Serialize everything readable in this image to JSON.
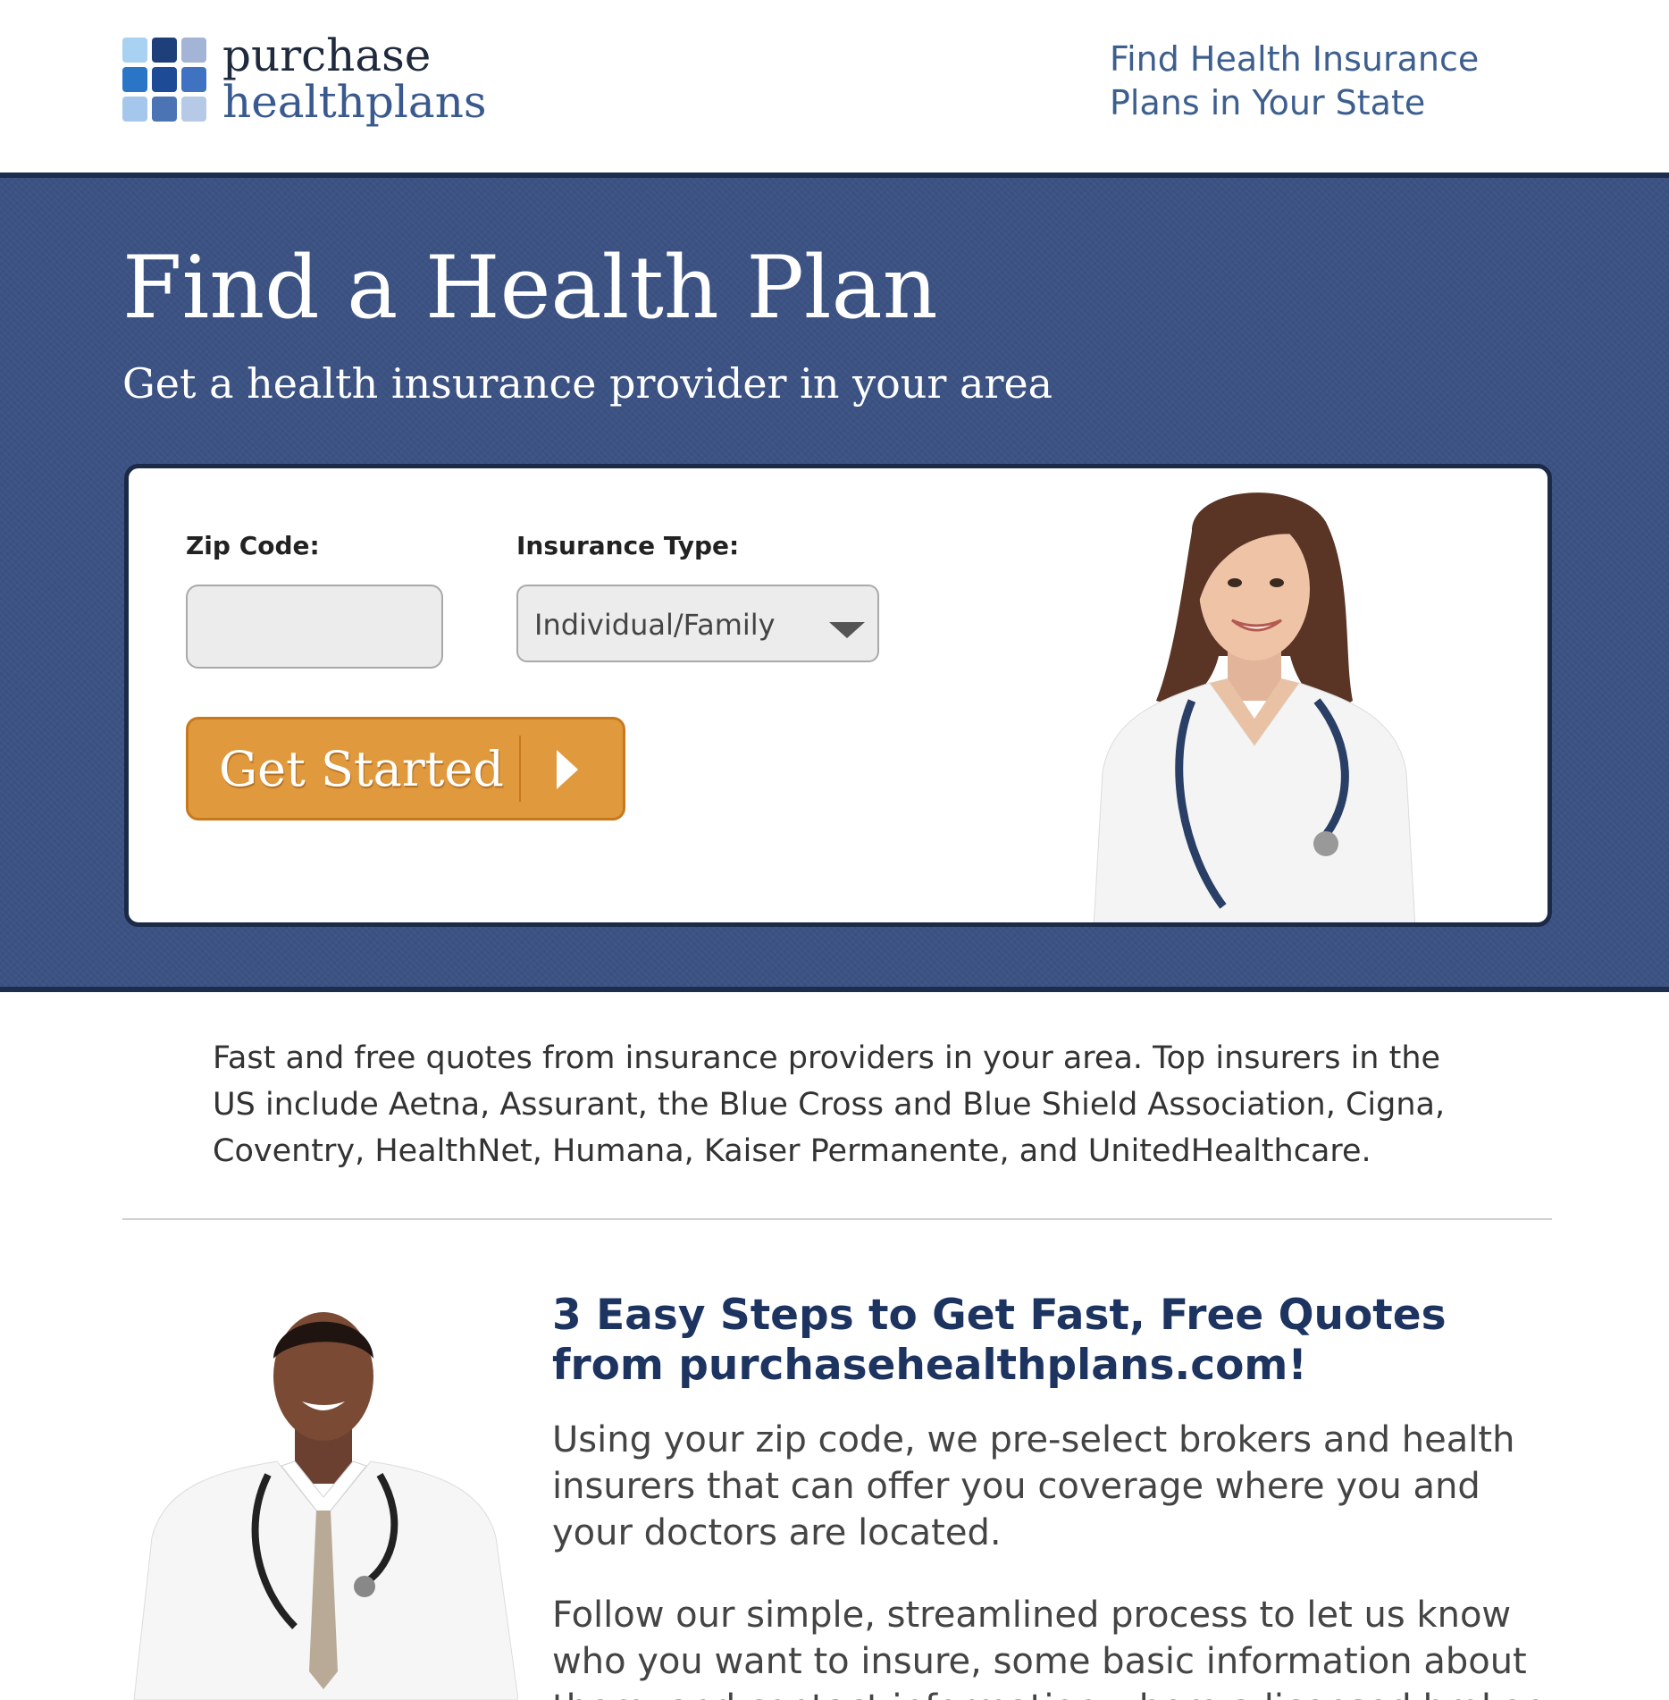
{
  "header": {
    "logo": {
      "line1": "purchase",
      "line2": "healthplans"
    },
    "state_link": "Find Health Insurance Plans in Your State"
  },
  "hero": {
    "title": "Find a Health Plan",
    "subtitle": "Get a health insurance provider in your area",
    "form": {
      "zip_label": "Zip Code:",
      "zip_value": "",
      "insurance_type_label": "Insurance Type:",
      "insurance_type_value": "Individual/Family",
      "submit_label": "Get Started"
    }
  },
  "intro": "Fast and free quotes from insurance providers in your area. Top insurers in the US include Aetna, Assurant, the Blue Cross and Blue Shield Association, Cigna, Coventry, HealthNet, Humana, Kaiser Permanente, and UnitedHealthcare.",
  "steps": {
    "title": "3 Easy Steps to Get Fast, Free Quotes from purchasehealthplans.com!",
    "paragraph1": "Using your zip code, we pre-select brokers and health insurers that can offer you coverage where you and your doctors are located.",
    "paragraph2": "Follow our simple, streamlined process to let us know who you want to insure, some basic information about them, and contact information where a licensed broker can reach you."
  },
  "colors": {
    "hero_bg": "#3b5283",
    "hero_border": "#1c2d4e",
    "cta": "#e0993d",
    "heading": "#1d3461",
    "link": "#3d5f8f"
  },
  "icons": {
    "logo_mark": "logo-grid-icon",
    "select_caret": "chevron-down-icon",
    "cta_arrow": "play-arrow-icon"
  }
}
